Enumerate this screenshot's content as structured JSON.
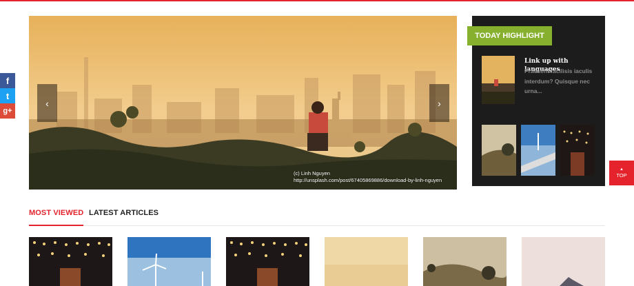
{
  "social": {
    "facebook_glyph": "f",
    "twitter_glyph": "t",
    "google_glyph": "g+"
  },
  "slider": {
    "prev_glyph": "‹",
    "next_glyph": "›",
    "credit_name": "(c) Linh Nguyen",
    "credit_url": "http://unsplash.com/post/67405869886/download-by-linh-nguyen"
  },
  "highlight": {
    "label": "TODAY HIGHLIGHT",
    "featured_title": "Link up with languages",
    "featured_excerpt": "Praesent facilisis iaculis interdum? Quisque nec urna..."
  },
  "back_to_top": {
    "arrow": "▲",
    "label": "TOP"
  },
  "tabs": [
    {
      "label": "MOST VIEWED",
      "active": true
    },
    {
      "label": "LATEST ARTICLES",
      "active": false
    }
  ],
  "colors": {
    "accent_red": "#e4232c",
    "highlight_green": "#88b02f",
    "panel_dark": "#1c1c1c"
  }
}
